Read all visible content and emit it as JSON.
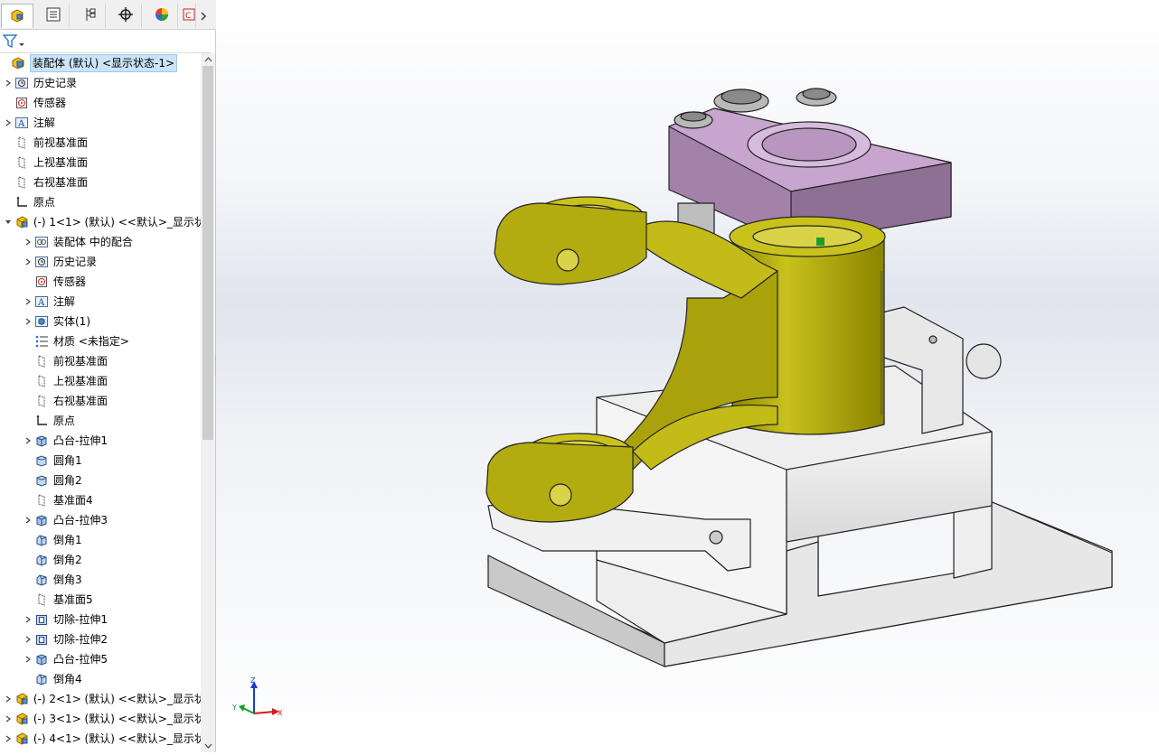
{
  "tabs": [
    {
      "name": "feature-manager-icon"
    },
    {
      "name": "property-manager-icon"
    },
    {
      "name": "configuration-manager-icon"
    },
    {
      "name": "dimxpert-manager-icon"
    },
    {
      "name": "display-manager-icon"
    },
    {
      "name": "cam-icon"
    }
  ],
  "tree": {
    "root": "装配体 (默认) <显示状态-1>",
    "items": [
      {
        "label": "历史记录",
        "icon": "history-icon",
        "expand": true
      },
      {
        "label": "传感器",
        "icon": "sensor-icon",
        "expand": false
      },
      {
        "label": "注解",
        "icon": "annotation-icon",
        "expand": true
      },
      {
        "label": "前视基准面",
        "icon": "plane-icon",
        "expand": false
      },
      {
        "label": "上视基准面",
        "icon": "plane-icon",
        "expand": false
      },
      {
        "label": "右视基准面",
        "icon": "plane-icon",
        "expand": false
      },
      {
        "label": "原点",
        "icon": "origin-icon",
        "expand": false
      },
      {
        "label": "(-) 1<1> (默认) <<默认>_显示状",
        "icon": "part-icon",
        "expand": "open"
      }
    ],
    "sub_items": [
      {
        "label": "装配体 中的配合",
        "icon": "mates-icon",
        "expand": true
      },
      {
        "label": "历史记录",
        "icon": "history-icon",
        "expand": true
      },
      {
        "label": "传感器",
        "icon": "sensor-icon",
        "expand": false
      },
      {
        "label": "注解",
        "icon": "annotation-icon",
        "expand": true
      },
      {
        "label": "实体(1)",
        "icon": "solid-body-icon",
        "expand": true
      },
      {
        "label": "材质 <未指定>",
        "icon": "material-icon",
        "expand": false
      },
      {
        "label": "前视基准面",
        "icon": "plane-icon",
        "expand": false
      },
      {
        "label": "上视基准面",
        "icon": "plane-icon",
        "expand": false
      },
      {
        "label": "右视基准面",
        "icon": "plane-icon",
        "expand": false
      },
      {
        "label": "原点",
        "icon": "origin-icon",
        "expand": false
      },
      {
        "label": "凸台-拉伸1",
        "icon": "extrude-icon",
        "expand": true
      },
      {
        "label": "圆角1",
        "icon": "fillet-icon",
        "expand": false
      },
      {
        "label": "圆角2",
        "icon": "fillet-icon",
        "expand": false
      },
      {
        "label": "基准面4",
        "icon": "plane-icon",
        "expand": false
      },
      {
        "label": "凸台-拉伸3",
        "icon": "extrude-icon",
        "expand": true
      },
      {
        "label": "倒角1",
        "icon": "chamfer-icon",
        "expand": false
      },
      {
        "label": "倒角2",
        "icon": "chamfer-icon",
        "expand": false
      },
      {
        "label": "倒角3",
        "icon": "chamfer-icon",
        "expand": false
      },
      {
        "label": "基准面5",
        "icon": "plane-icon",
        "expand": false
      },
      {
        "label": "切除-拉伸1",
        "icon": "cut-extrude-icon",
        "expand": true
      },
      {
        "label": "切除-拉伸2",
        "icon": "cut-extrude-icon",
        "expand": true
      },
      {
        "label": "凸台-拉伸5",
        "icon": "extrude-icon",
        "expand": true
      },
      {
        "label": "倒角4",
        "icon": "chamfer-icon",
        "expand": false
      }
    ],
    "tail_items": [
      {
        "label": "(-) 2<1> (默认) <<默认>_显示状",
        "icon": "part-icon",
        "expand": true
      },
      {
        "label": "(-) 3<1> (默认) <<默认>_显示状",
        "icon": "part-icon",
        "expand": true
      },
      {
        "label": "(-) 4<1> (默认) <<默认>_显示状",
        "icon": "part-icon",
        "expand": true
      }
    ]
  },
  "triad": {
    "x": "X",
    "y": "Y",
    "z": "Z"
  },
  "colors": {
    "part_yellow": "#b5ad10",
    "part_purple": "#c7a5cf",
    "part_gray": "#e4e4e4",
    "selection": "#cce4f7"
  }
}
